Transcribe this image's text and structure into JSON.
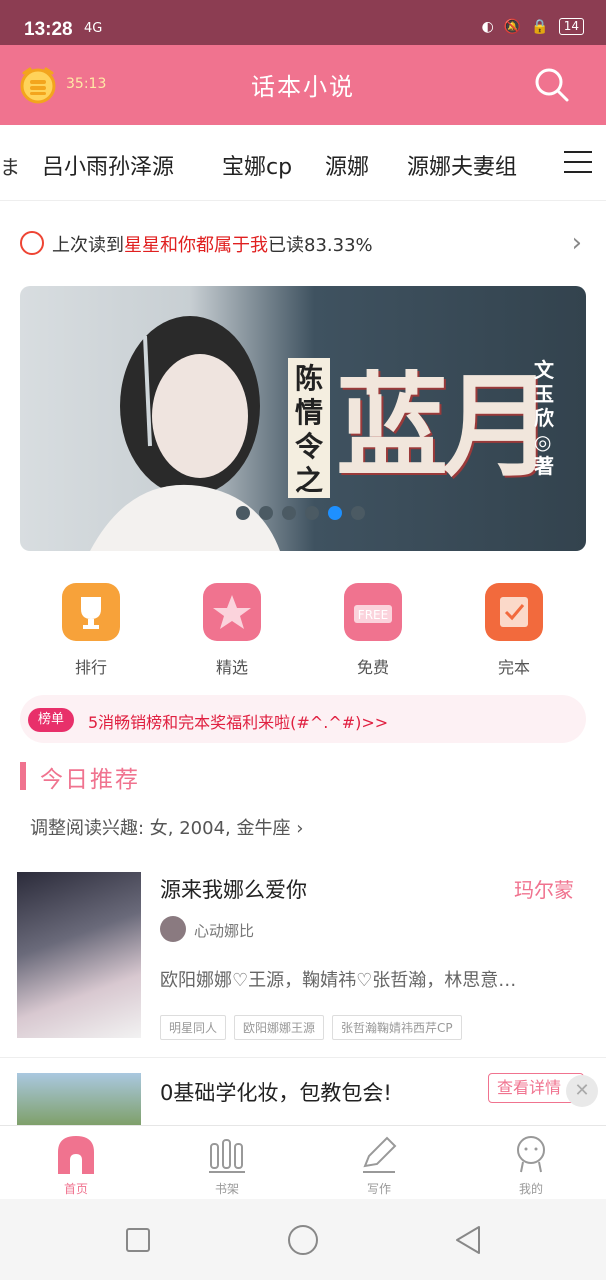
{
  "status_bar": {
    "time": "13:28",
    "signal": "4G",
    "battery": "14"
  },
  "app_bar": {
    "clock_time": "35:13",
    "title": "话本小说"
  },
  "tag_bar": {
    "edge_text": "ま",
    "tags": [
      "吕小雨孙泽源",
      "宝娜cp",
      "源娜",
      "源娜夫妻组"
    ]
  },
  "last_read": {
    "prefix": "上次读到",
    "book": "星星和你都属于我",
    "suffix": "已读83.33%"
  },
  "banner": {
    "vertical_title": "陈情令之",
    "big_title": "蓝月",
    "author": "文玉欣◎著",
    "dot_count": 6,
    "active_dot": 4
  },
  "categories": [
    {
      "label": "排行",
      "icon": "trophy-icon",
      "color": "#f7a23a"
    },
    {
      "label": "精选",
      "icon": "star-icon",
      "color": "#f0738f"
    },
    {
      "label": "免费",
      "icon": "free-icon",
      "color": "#f0738f"
    },
    {
      "label": "完本",
      "icon": "check-book-icon",
      "color": "#f26a3d"
    }
  ],
  "notice": {
    "badge": "榜单",
    "text": "5消畅销榜和完本奖福利来啦(#^.^#)>>"
  },
  "section": {
    "title": "今日推荐",
    "preference": "调整阅读兴趣: 女, 2004, 金牛座 ›"
  },
  "recommend_1": {
    "title": "源来我娜么爱你",
    "tag": "玛尔蒙",
    "author": "心动娜比",
    "description": "欧阳娜娜♡王源，鞠婧祎♡张哲瀚，林思意…",
    "chips": [
      "明星同人",
      "欧阳娜娜王源",
      "张哲瀚鞠婧祎西芹CP"
    ]
  },
  "recommend_2": {
    "title": "0基础学化妆，包教包会!",
    "detail_button": "查看详情",
    "close": "✕"
  },
  "tab_bar": [
    {
      "label": "首页",
      "active": true
    },
    {
      "label": "书架",
      "active": false
    },
    {
      "label": "写作",
      "active": false
    },
    {
      "label": "我的",
      "active": false
    }
  ]
}
